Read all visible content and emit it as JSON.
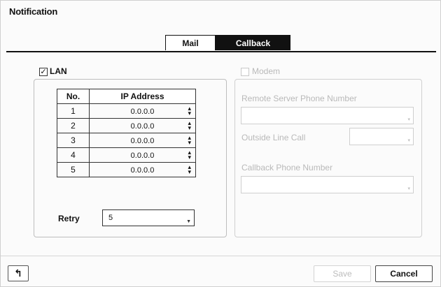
{
  "dialog": {
    "title": "Notification"
  },
  "tabs": [
    {
      "label": "Mail",
      "active": false
    },
    {
      "label": "Callback",
      "active": true
    }
  ],
  "lan": {
    "label": "LAN",
    "checked": true,
    "table": {
      "headers": [
        "No.",
        "IP Address"
      ],
      "rows": [
        {
          "no": "1",
          "ip": "0.0.0.0"
        },
        {
          "no": "2",
          "ip": "0.0.0.0"
        },
        {
          "no": "3",
          "ip": "0.0.0.0"
        },
        {
          "no": "4",
          "ip": "0.0.0.0"
        },
        {
          "no": "5",
          "ip": "0.0.0.0"
        }
      ]
    },
    "retry": {
      "label": "Retry",
      "value": "5"
    }
  },
  "modem": {
    "label": "Modem",
    "checked": false,
    "enabled": false,
    "remote_server_label": "Remote Server Phone Number",
    "remote_server_value": "",
    "outside_line_label": "Outside Line Call",
    "outside_line_value": "",
    "callback_phone_label": "Callback Phone Number",
    "callback_phone_value": ""
  },
  "footer": {
    "back_icon": "back-arrow-icon",
    "save_label": "Save",
    "cancel_label": "Cancel"
  },
  "colors": {
    "active_tab_bg": "#111111",
    "disabled_text": "#b9b9b9"
  }
}
